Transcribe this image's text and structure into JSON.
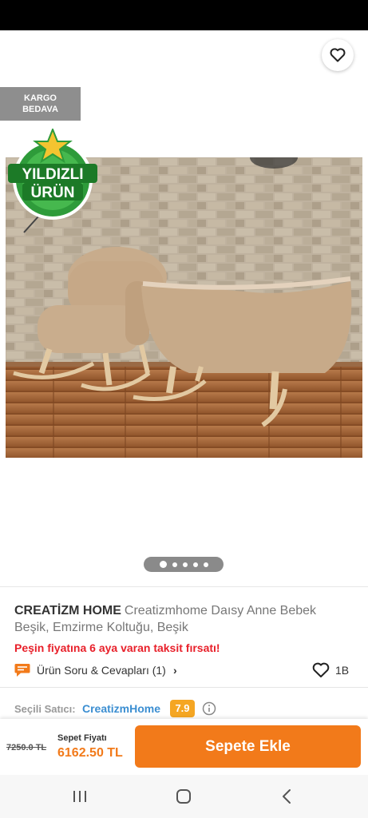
{
  "colors": {
    "accent": "#f27a1a",
    "promo": "#e8202a",
    "seller_link": "#3b8ed1",
    "score_badge": "#f5a623",
    "cargo_badge": "#8e8e8e"
  },
  "topbar": {
    "back_icon": "arrow-left-icon",
    "share_icon": "share-icon",
    "favorite_icon": "heart-outline-icon"
  },
  "badges": {
    "cargo_line1": "KARGO",
    "cargo_line2": "BEDAVA",
    "featured_line1": "YILDIZLI",
    "featured_line2": "ÜRÜN"
  },
  "gallery": {
    "image_count": 5,
    "active_index": 0
  },
  "product": {
    "brand": "CREATİZM HOME",
    "name": "Creatizmhome Daısy Anne Bebek Beşik, Emzirme Koltuğu, Beşik",
    "promo_text": "Peşin fiyatına 6 aya varan taksit fırsatı!",
    "qa_label": "Ürün Soru & Cevapları (1)",
    "qa_chevron": "›",
    "like_count": "1B"
  },
  "seller": {
    "label": "Seçili Satıcı:",
    "name": "CreatizmHome",
    "score": "7.9"
  },
  "purchase": {
    "old_price": "7250.0 TL",
    "basket_label": "Sepet Fiyatı",
    "price": "6162.50 TL",
    "add_button": "Sepete Ekle"
  },
  "navbar": {
    "recents_icon": "recents-icon",
    "home_icon": "home-icon",
    "back_icon": "nav-back-icon"
  }
}
